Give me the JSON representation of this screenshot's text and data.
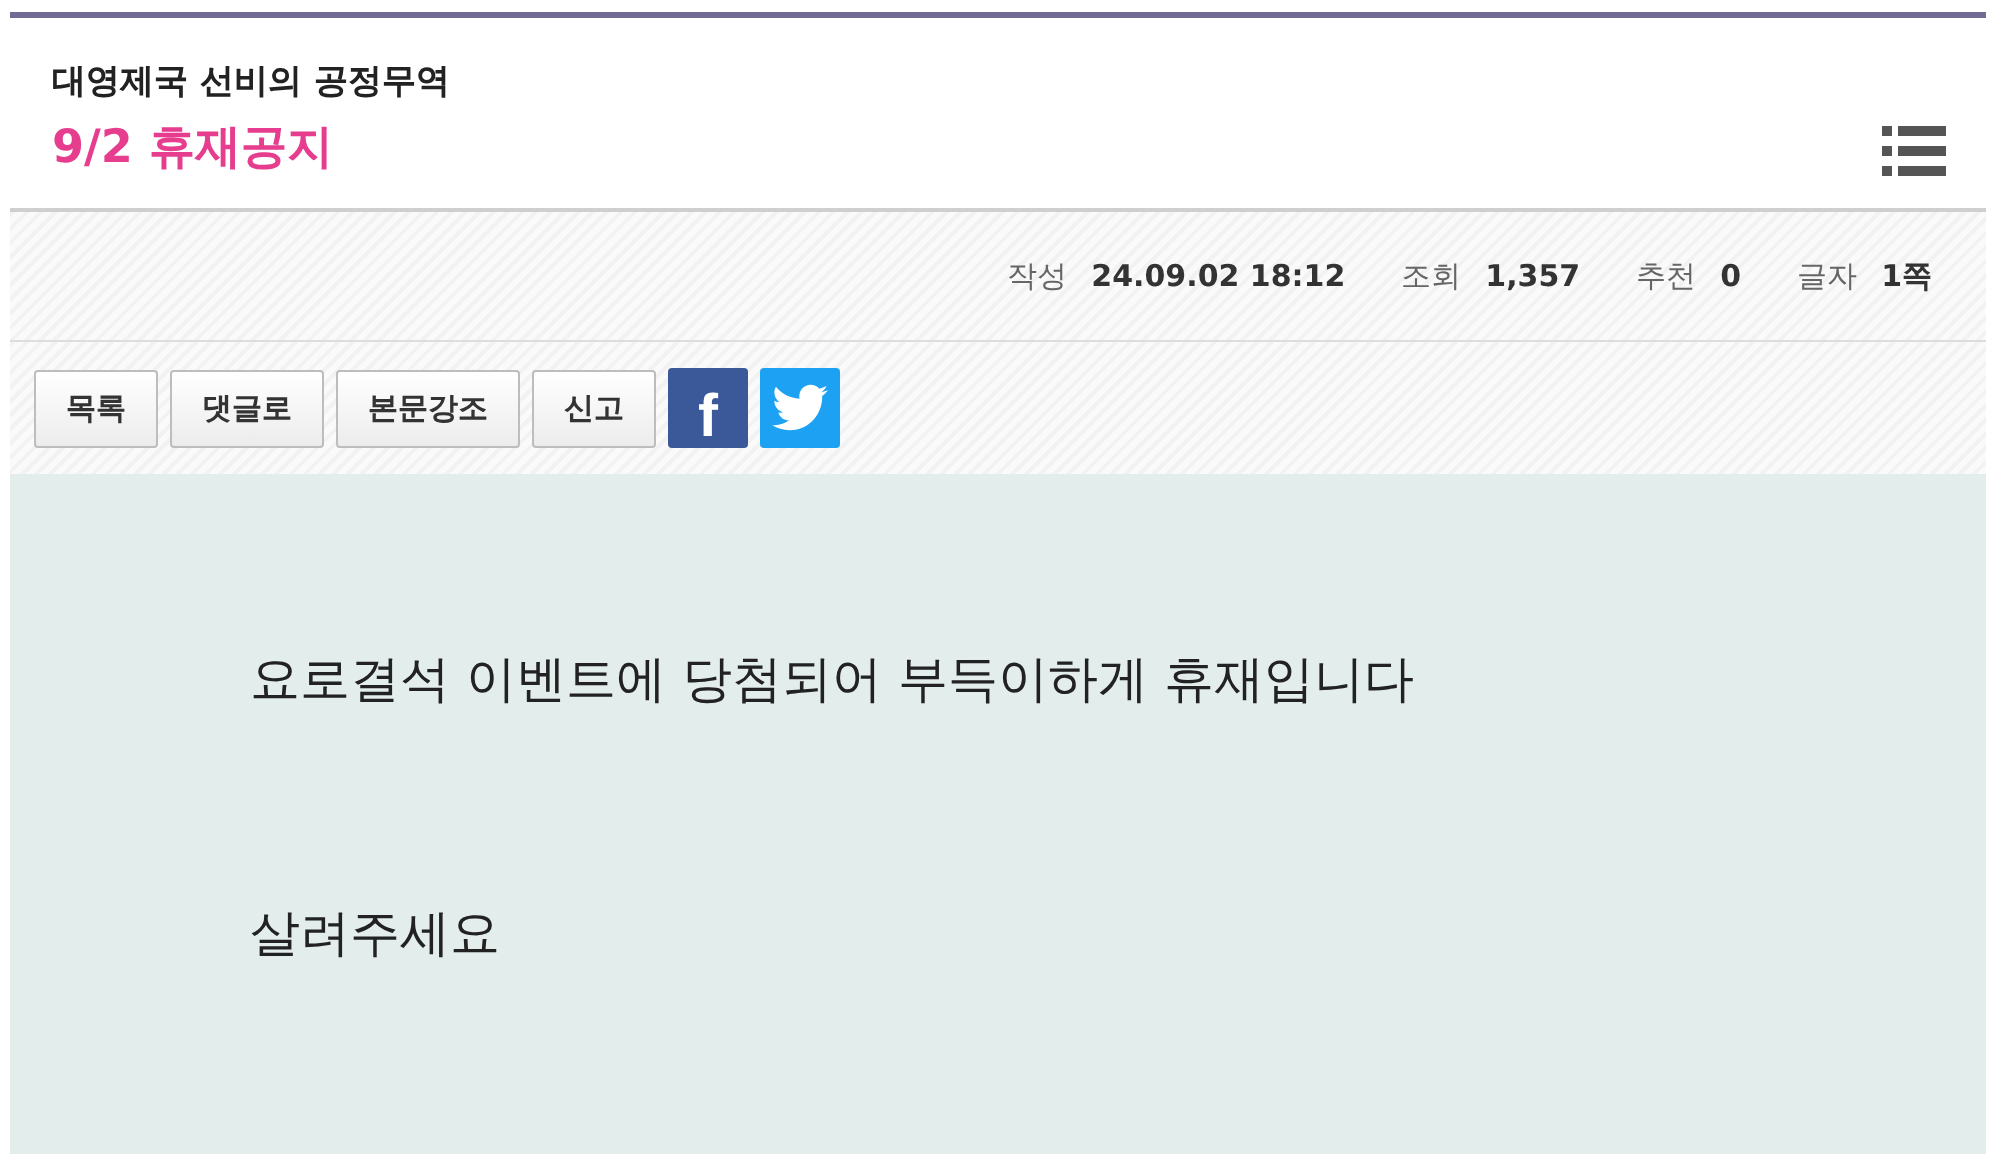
{
  "board": {
    "name": "대영제국 선비의 공정무역"
  },
  "post": {
    "title": "9/2 휴재공지"
  },
  "meta": [
    {
      "label": "작성",
      "value": "24.09.02 18:12"
    },
    {
      "label": "조회",
      "value": "1,357"
    },
    {
      "label": "추천",
      "value": "0"
    },
    {
      "label": "글자",
      "value": "1쪽"
    }
  ],
  "actions": [
    {
      "kind": "button",
      "label": "목록"
    },
    {
      "kind": "button",
      "label": "댓글로"
    },
    {
      "kind": "button",
      "label": "본문강조"
    },
    {
      "kind": "button",
      "label": "신고"
    },
    {
      "kind": "facebook",
      "label": "f"
    },
    {
      "kind": "twitter"
    }
  ],
  "body": [
    "요로결석 이벤트에 당첨되어 부득이하게 휴재입니다",
    "살려주세요"
  ]
}
